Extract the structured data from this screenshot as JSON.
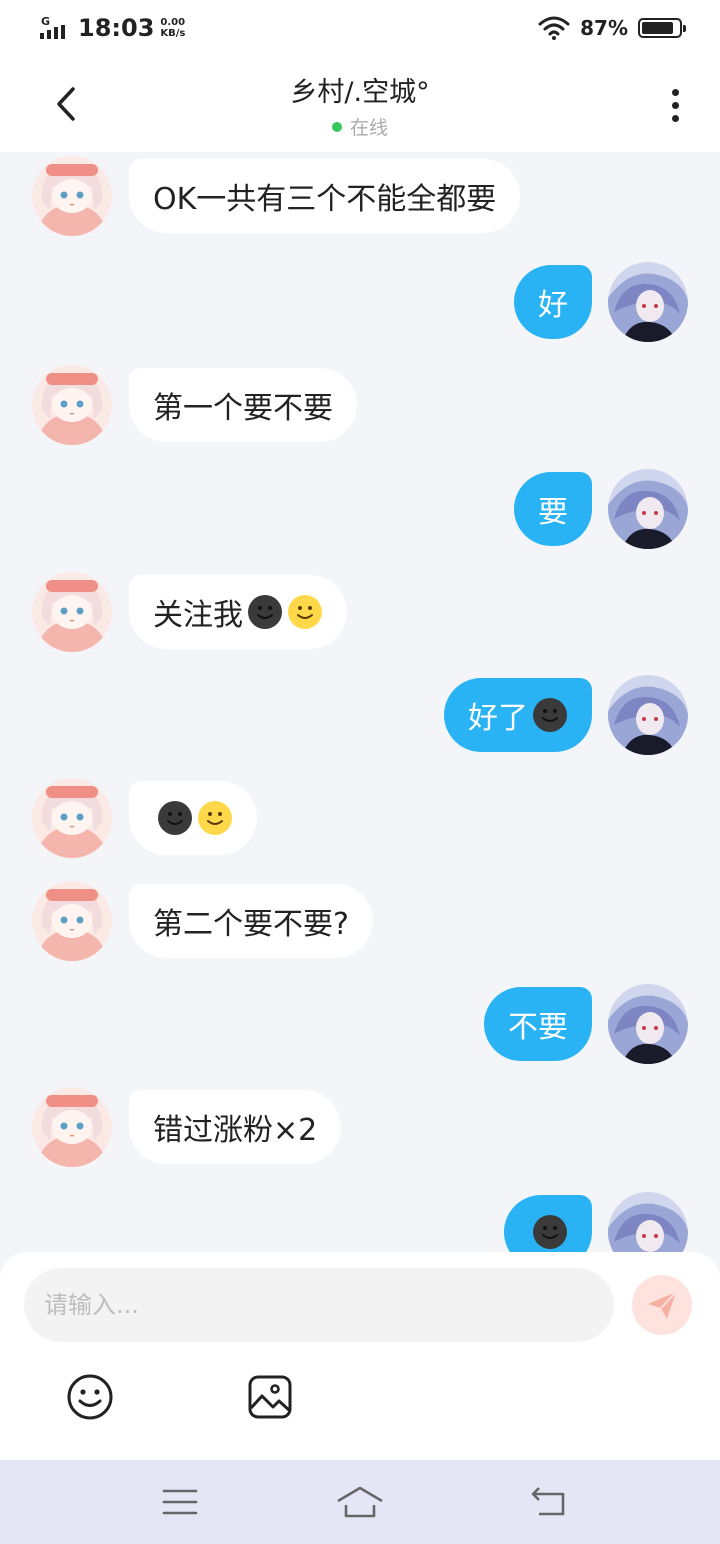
{
  "status_bar": {
    "network": "G",
    "time": "18:03",
    "speed_value": "0.00",
    "speed_unit": "KB/s",
    "battery_pct": "87%",
    "battery_level": 0.87
  },
  "header": {
    "back_icon": "chevron-left-icon",
    "title": "乡村/.空城°",
    "status_text": "在线",
    "status_color": "#34c759",
    "more_icon": "more-vertical-icon"
  },
  "messages": [
    {
      "side": "in",
      "text": "OK一共有三个不能全都要",
      "emojis": []
    },
    {
      "side": "out",
      "text": "好",
      "emojis": []
    },
    {
      "side": "in",
      "text": "第一个要不要",
      "emojis": []
    },
    {
      "side": "out",
      "text": "要",
      "emojis": []
    },
    {
      "side": "in",
      "text": "关注我",
      "emojis": [
        "dark-smile-emoji",
        "smile-emoji"
      ]
    },
    {
      "side": "out",
      "text": "好了",
      "emojis": [
        "dark-smile-emoji"
      ]
    },
    {
      "side": "in",
      "text": "",
      "emojis": [
        "dark-smile-emoji",
        "smile-emoji"
      ]
    },
    {
      "side": "in",
      "text": "第二个要不要?",
      "emojis": []
    },
    {
      "side": "out",
      "text": "不要",
      "emojis": []
    },
    {
      "side": "in",
      "text": "错过涨粉×2",
      "emojis": []
    },
    {
      "side": "out",
      "text": "",
      "emojis": [
        "dark-smile-emoji"
      ]
    }
  ],
  "composer": {
    "placeholder": "请输入...",
    "value": "",
    "send_icon": "send-icon",
    "tools": [
      "emoji-icon",
      "image-icon"
    ]
  },
  "nav_bar": {
    "buttons": [
      "menu-icon",
      "home-icon",
      "back-icon"
    ]
  },
  "colors": {
    "outgoing_bubble": "#29b3f4",
    "incoming_bubble": "#ffffff",
    "chat_background": "#f3f5f8",
    "send_button": "#fde2dd",
    "nav_background": "#e4e6f5"
  }
}
